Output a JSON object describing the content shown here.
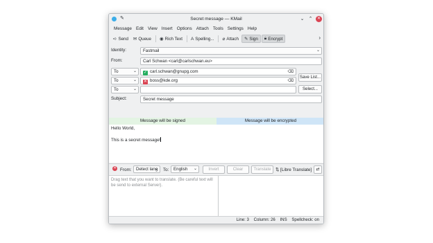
{
  "window": {
    "title": "Secret message — KMail"
  },
  "menubar": [
    "Message",
    "Edit",
    "View",
    "Insert",
    "Options",
    "Attach",
    "Tools",
    "Settings",
    "Help"
  ],
  "toolbar": {
    "send": "Send",
    "queue": "Queue",
    "rich_text": "Rich Text",
    "spelling": "Spelling...",
    "attach": "Attach",
    "sign": "Sign",
    "encrypt": "Encrypt"
  },
  "header": {
    "identity_label": "Identity:",
    "identity_value": "Fastmail",
    "from_label": "From:",
    "from_value": "Carl Schwan <carl@carlschwan.eu>",
    "recipients": [
      {
        "type": "To",
        "address": "carl.schwan@gnupg.com",
        "key_status": "valid"
      },
      {
        "type": "To",
        "address": "boss@kde.org",
        "key_status": "missing"
      },
      {
        "type": "To",
        "address": "",
        "key_status": "none"
      }
    ],
    "save_list": "Save List...",
    "select": "Select...",
    "subject_label": "Subject:",
    "subject_value": "Secret message"
  },
  "status_banners": {
    "signed": "Message will be signed",
    "encrypted": "Message will be encrypted"
  },
  "body": {
    "line1": "Hello World,",
    "line2": "This is a secret message!"
  },
  "translator": {
    "from_label": "From:",
    "from_value": "Detect lang",
    "to_label": "To:",
    "to_value": "English",
    "invert": "Invert",
    "clear": "Clear",
    "translate": "Translate",
    "engine": "[Libre Translate]",
    "placeholder": "Drag text that you want to translate. (Be careful text will be send to external Server)."
  },
  "statusbar": {
    "line": "Line: 3",
    "column": "Column: 26",
    "ins": "INS",
    "spellcheck": "Spellcheck: on"
  },
  "colors": {
    "signed_bg": "#e3f4e3",
    "encrypted_bg": "#cfe5f7",
    "close": "#da4453",
    "ok": "#27ae60"
  }
}
